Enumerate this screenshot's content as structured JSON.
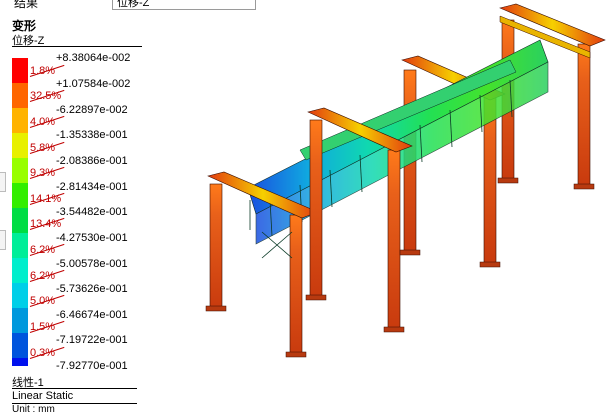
{
  "header": {
    "label": "结果",
    "combo_value": "位移-Z"
  },
  "legend": {
    "title": "变形",
    "subtitle": "位移-Z",
    "colors": [
      "#ff0000",
      "#ff6600",
      "#ffb300",
      "#e8f000",
      "#99ff00",
      "#33ee00",
      "#00dd44",
      "#00ee99",
      "#00eecc",
      "#00cfe8",
      "#0099dd",
      "#0055dd",
      "#0011ee"
    ],
    "percents": [
      "1.8%",
      "32.5%",
      "4.0%",
      "5.8%",
      "9.3%",
      "14.1%",
      "13.4%",
      "6.2%",
      "6.2%",
      "5.0%",
      "1.5%",
      "0.3%"
    ],
    "values": [
      "+8.38064e-002",
      "+1.07584e-002",
      "-6.22897e-002",
      "-1.35338e-001",
      "-2.08386e-001",
      "-2.81434e-001",
      "-3.54482e-001",
      "-4.27530e-001",
      "-5.00578e-001",
      "-5.73626e-001",
      "-6.46674e-001",
      "-7.19722e-001",
      "-7.92770e-001"
    ]
  },
  "footer": {
    "load_case": "线性-1",
    "analysis_type": "Linear Static",
    "unit": "Unit : mm"
  }
}
